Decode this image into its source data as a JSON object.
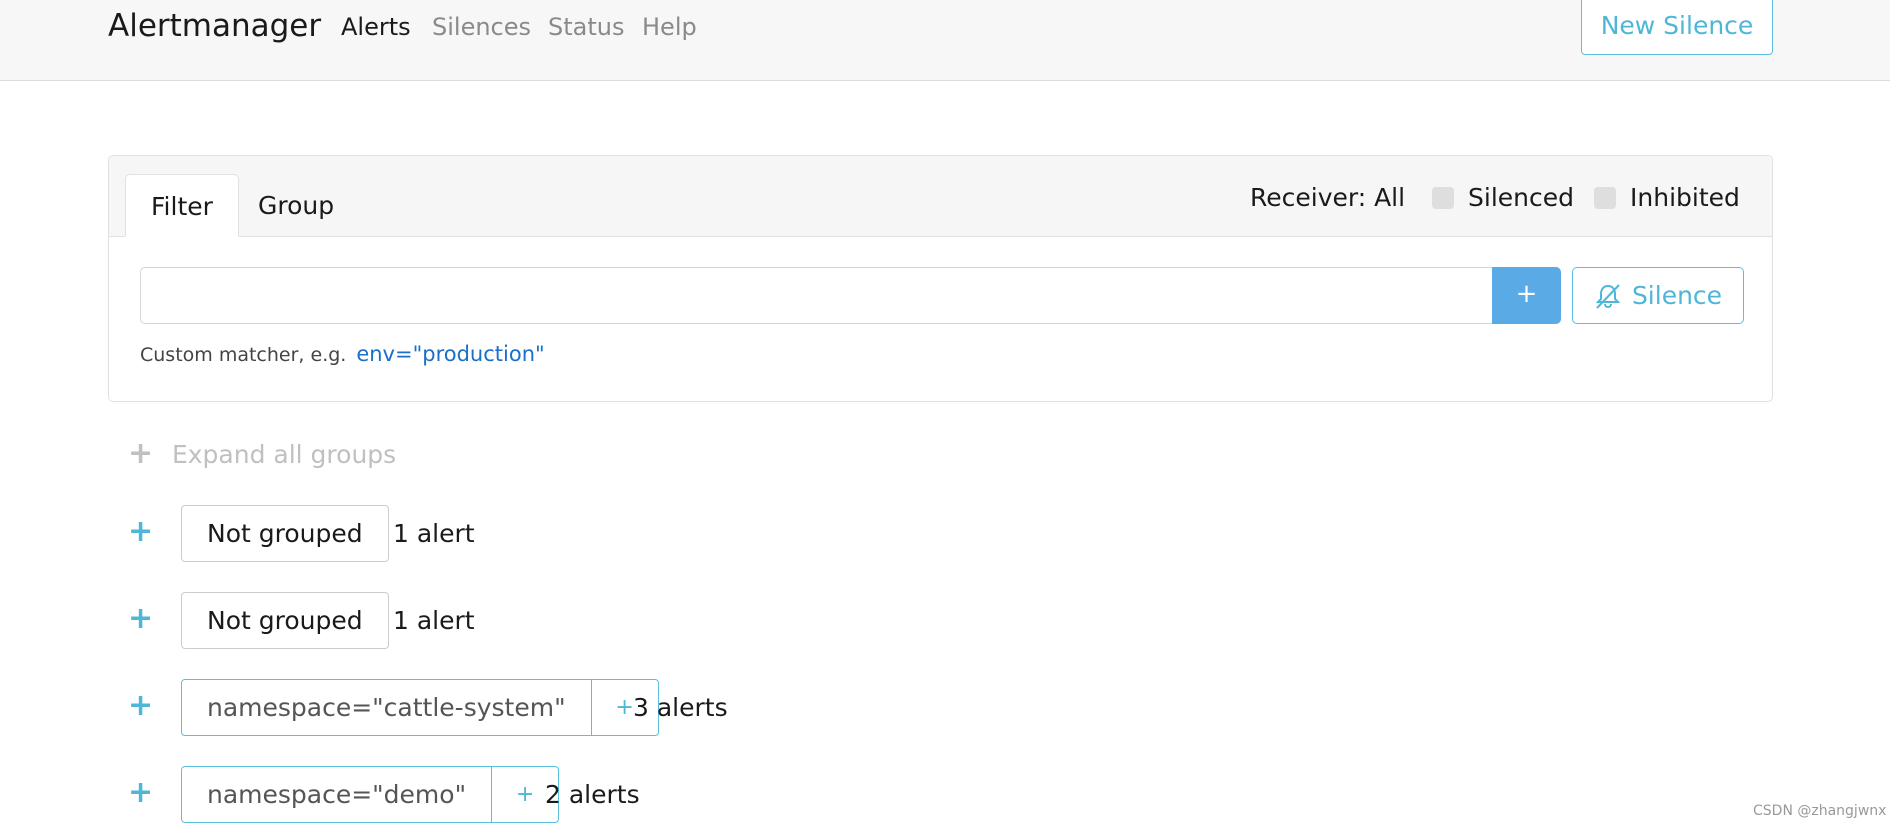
{
  "navbar": {
    "brand": "Alertmanager",
    "links": [
      {
        "label": "Alerts",
        "active": true
      },
      {
        "label": "Silences",
        "active": false
      },
      {
        "label": "Status",
        "active": false
      },
      {
        "label": "Help",
        "active": false
      }
    ],
    "new_silence_label": "New Silence"
  },
  "filter_card": {
    "tabs": [
      {
        "label": "Filter",
        "active": true
      },
      {
        "label": "Group",
        "active": false
      }
    ],
    "receiver_label": "Receiver: All",
    "checkboxes": [
      {
        "label": "Silenced",
        "checked": false
      },
      {
        "label": "Inhibited",
        "checked": false
      }
    ],
    "input_value": "",
    "add_button_label": "+",
    "silence_button_label": "Silence",
    "hint_text": "Custom matcher, e.g.",
    "hint_example": "env=\"production\""
  },
  "expand_all_label": "Expand all groups",
  "groups": [
    {
      "label": "Not grouped",
      "count": "1 alert",
      "type": "plain"
    },
    {
      "label": "Not grouped",
      "count": "1 alert",
      "type": "plain"
    },
    {
      "label": "namespace=\"cattle-system\"",
      "count": "3 alerts",
      "type": "matcher"
    },
    {
      "label": "namespace=\"demo\"",
      "count": "2 alerts",
      "type": "matcher"
    }
  ],
  "watermark": "CSDN @zhangjwnx",
  "colors": {
    "accent": "#5bc0de",
    "primary_button": "#5aaae6",
    "link_blue": "#1a6fc9"
  }
}
